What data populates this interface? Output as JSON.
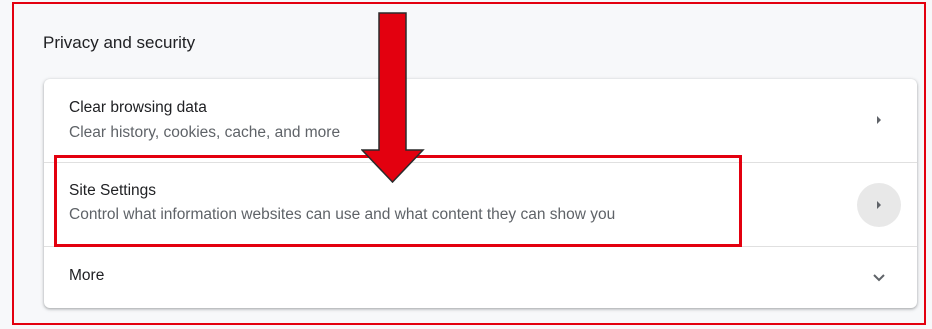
{
  "section": {
    "title": "Privacy and security"
  },
  "rows": [
    {
      "title": "Clear browsing data",
      "subtitle": "Clear history, cookies, cache, and more"
    },
    {
      "title": "Site Settings",
      "subtitle": "Control what information websites can use and what content they can show you"
    },
    {
      "title": "More"
    }
  ],
  "icons": {
    "row1": "chevron-right-icon",
    "row2": "chevron-right-icon",
    "row3": "chevron-down-icon"
  },
  "colors": {
    "annotation_red": "#e3000f",
    "card_bg": "#ffffff",
    "page_bg": "#f7f8fa",
    "text_primary": "#202124",
    "text_secondary": "#5f6368",
    "hover_circle": "#e8e8e8"
  }
}
